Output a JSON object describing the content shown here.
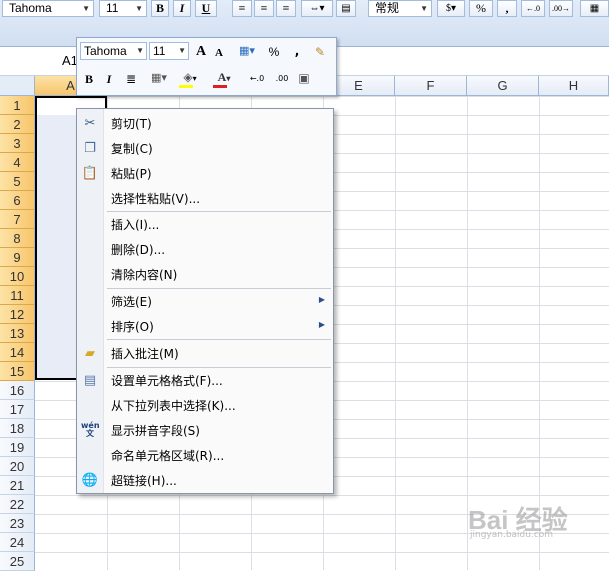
{
  "ribbon": {
    "font_name": "Tahoma",
    "font_size": "11",
    "bold": "B",
    "italic": "I",
    "underline": "U",
    "number_format": "常规",
    "percent": "%",
    "comma": ","
  },
  "formula_bar": {
    "name_box": "A1"
  },
  "columns": [
    "A",
    "B",
    "C",
    "D",
    "E",
    "F",
    "G",
    "H"
  ],
  "rows": [
    "1",
    "2",
    "3",
    "4",
    "5",
    "6",
    "7",
    "8",
    "9",
    "10",
    "11",
    "12",
    "13",
    "14",
    "15",
    "16",
    "17",
    "18",
    "19",
    "20",
    "21",
    "22",
    "23",
    "24",
    "25"
  ],
  "mini_toolbar": {
    "font_name": "Tahoma",
    "font_size": "11",
    "grow_font": "A",
    "shrink_font": "A",
    "percent": "%",
    "comma": ",",
    "bold": "B",
    "italic": "I",
    "font_color": "A"
  },
  "context_menu": {
    "items": [
      {
        "label": "剪切(T)",
        "icon": "scissors-icon"
      },
      {
        "label": "复制(C)",
        "icon": "copy-icon"
      },
      {
        "label": "粘贴(P)",
        "icon": "paste-icon"
      },
      {
        "label": "选择性粘贴(V)...",
        "icon": ""
      },
      {
        "label": "插入(I)...",
        "icon": ""
      },
      {
        "label": "删除(D)...",
        "icon": ""
      },
      {
        "label": "清除内容(N)",
        "icon": ""
      },
      {
        "label": "筛选(E)",
        "icon": "",
        "submenu": true
      },
      {
        "label": "排序(O)",
        "icon": "",
        "submenu": true
      },
      {
        "label": "插入批注(M)",
        "icon": "comment-icon"
      },
      {
        "label": "设置单元格格式(F)...",
        "icon": "format-cells-icon"
      },
      {
        "label": "从下拉列表中选择(K)...",
        "icon": ""
      },
      {
        "label": "显示拼音字段(S)",
        "icon": "phonetic-icon",
        "icon_text": "wén 文"
      },
      {
        "label": "命名单元格区域(R)...",
        "icon": ""
      },
      {
        "label": "超链接(H)...",
        "icon": "hyperlink-icon"
      }
    ]
  },
  "watermark": {
    "text": "Bai 经验",
    "sub": "jingyan.baidu.com"
  },
  "colors": {
    "accent": "#f7c56b",
    "selection": "#e8ecf6",
    "header": "#e4ecf7"
  }
}
